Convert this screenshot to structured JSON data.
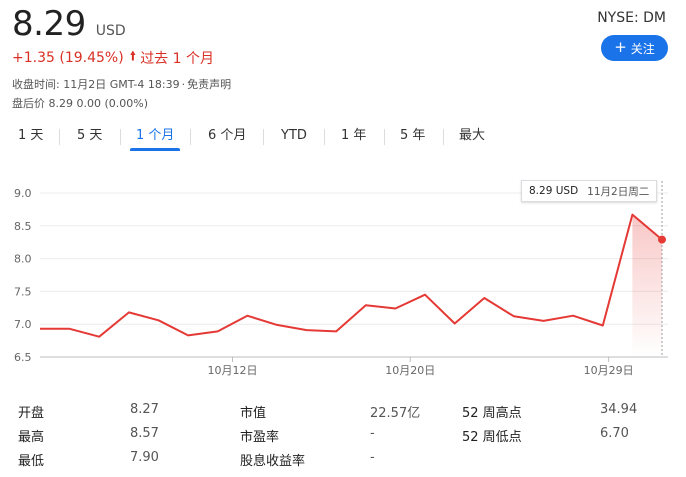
{
  "quote": {
    "price": "8.29",
    "currency": "USD",
    "exchange": "NYSE: DM",
    "follow_label": "关注",
    "change": "+1.35 (19.45%)",
    "change_period": "过去 1 个月",
    "close_time": "收盘时间: 11月2日 GMT-4 18:39",
    "disclaimer": "免责声明",
    "after_hours": "盘后价 8.29 0.00 (0.00%)"
  },
  "tabs": [
    {
      "label": "1 天",
      "active": false
    },
    {
      "label": "5 天",
      "active": false
    },
    {
      "label": "1 个月",
      "active": true
    },
    {
      "label": "6 个月",
      "active": false
    },
    {
      "label": "YTD",
      "active": false
    },
    {
      "label": "1 年",
      "active": false
    },
    {
      "label": "5 年",
      "active": false
    },
    {
      "label": "最大",
      "active": false
    }
  ],
  "chart_data": {
    "type": "area",
    "ylim": [
      6.5,
      9.0
    ],
    "yticks": [
      "9.0",
      "8.5",
      "8.0",
      "7.5",
      "7.0",
      "6.5"
    ],
    "xtick_labels": [
      "10月12日",
      "10月20日",
      "10月29日"
    ],
    "values": [
      6.93,
      6.93,
      6.81,
      7.18,
      7.06,
      6.83,
      6.89,
      7.13,
      6.99,
      6.91,
      6.89,
      7.29,
      7.24,
      7.45,
      7.01,
      7.4,
      7.12,
      7.05,
      7.13,
      6.98,
      8.67,
      8.29
    ],
    "tooltip_value": "8.29 USD",
    "tooltip_date": "11月2日周二",
    "line_color": "#e53935"
  },
  "stats": [
    {
      "label": "开盘",
      "value": "8.27"
    },
    {
      "label": "最高",
      "value": "8.57"
    },
    {
      "label": "最低",
      "value": "7.90"
    },
    {
      "label": "市值",
      "value": "22.57亿"
    },
    {
      "label": "市盈率",
      "value": "-"
    },
    {
      "label": "股息收益率",
      "value": "-"
    },
    {
      "label": "52 周高点",
      "value": "34.94"
    },
    {
      "label": "52 周低点",
      "value": "6.70"
    }
  ]
}
